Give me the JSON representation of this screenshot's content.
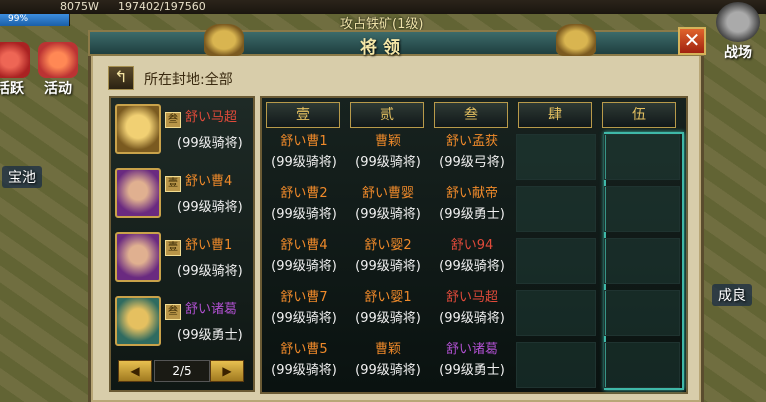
{
  "hud": {
    "gold": "8075W",
    "troops": "197402/197560",
    "hp_percent": "99%",
    "top_title": "攻占铁矿(1级)"
  },
  "side_buttons": {
    "left1": "活跃",
    "left2": "活动",
    "right": "战场"
  },
  "map_labels": {
    "left_city": "宝池",
    "right_city": "成良"
  },
  "panel": {
    "title": "将领",
    "close_label": "✕",
    "back_label": "↰",
    "fief_label": "所在封地:全部"
  },
  "generals": [
    {
      "badge": "叁",
      "name": "舒い马超",
      "rank": "(99级骑将)",
      "color": "#e04a3a",
      "portrait": "p-gold"
    },
    {
      "badge": "壹",
      "name": "舒い曹4",
      "rank": "(99级骑将)",
      "color": "#f08a2a",
      "portrait": "p-purple"
    },
    {
      "badge": "壹",
      "name": "舒い曹1",
      "rank": "(99级骑将)",
      "color": "#f08a2a",
      "portrait": "p-purple"
    },
    {
      "badge": "叁",
      "name": "舒い诸葛",
      "rank": "(99级勇士)",
      "color": "#b050d0",
      "portrait": "p-teal"
    }
  ],
  "pager": {
    "prev": "◀",
    "text": "2/5",
    "next": "▶"
  },
  "columns": [
    "壹",
    "贰",
    "叁",
    "肆",
    "伍"
  ],
  "grid_rows": [
    [
      {
        "name": "舒い曹1",
        "rank": "(99级骑将)",
        "color": "#f08a2a"
      },
      {
        "name": "曹颖",
        "rank": "(99级骑将)",
        "color": "#f08a2a"
      },
      {
        "name": "舒い孟获",
        "rank": "(99级弓将)",
        "color": "#f08a2a"
      }
    ],
    [
      {
        "name": "舒い曹2",
        "rank": "(99级骑将)",
        "color": "#f08a2a"
      },
      {
        "name": "舒い曹婴",
        "rank": "(99级骑将)",
        "color": "#f08a2a"
      },
      {
        "name": "舒い献帝",
        "rank": "(99级勇士)",
        "color": "#f08a2a"
      }
    ],
    [
      {
        "name": "舒い曹4",
        "rank": "(99级骑将)",
        "color": "#f08a2a"
      },
      {
        "name": "舒い婴2",
        "rank": "(99级骑将)",
        "color": "#f08a2a"
      },
      {
        "name": "舒い94",
        "rank": "(99级骑将)",
        "color": "#e04a3a"
      }
    ],
    [
      {
        "name": "舒い曹7",
        "rank": "(99级骑将)",
        "color": "#f08a2a"
      },
      {
        "name": "舒い婴1",
        "rank": "(99级骑将)",
        "color": "#f08a2a"
      },
      {
        "name": "舒い马超",
        "rank": "(99级骑将)",
        "color": "#e04a3a"
      }
    ],
    [
      {
        "name": "舒い曹5",
        "rank": "(99级骑将)",
        "color": "#f08a2a"
      },
      {
        "name": "曹颖",
        "rank": "(99级骑将)",
        "color": "#f08a2a"
      },
      {
        "name": "舒い诸葛",
        "rank": "(99级勇士)",
        "color": "#b050d0"
      }
    ]
  ]
}
